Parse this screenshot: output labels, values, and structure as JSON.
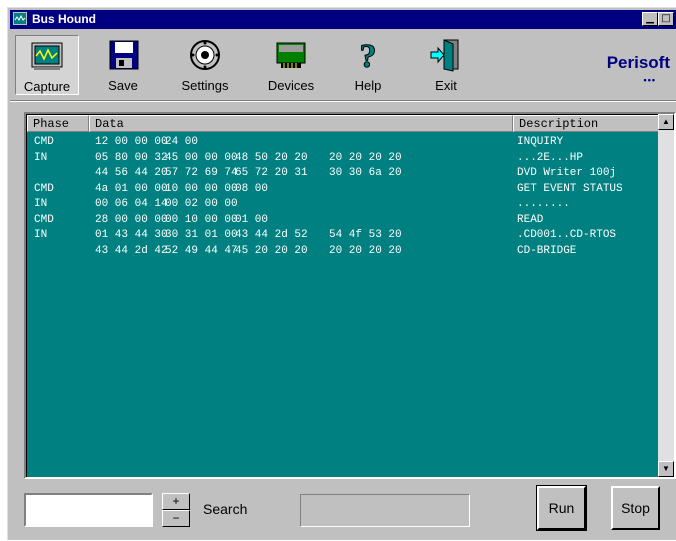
{
  "window": {
    "title": "Bus Hound"
  },
  "toolbar": {
    "capture": "Capture",
    "save": "Save",
    "settings": "Settings",
    "devices": "Devices",
    "help": "Help",
    "exit": "Exit"
  },
  "brand": {
    "name": "Perisoft",
    "dots": "•••"
  },
  "table": {
    "columns": [
      "Phase",
      "Data",
      "Description"
    ],
    "rows": [
      {
        "phase": "CMD",
        "d1": "12 00 00 00",
        "d2": "24 00",
        "d3": "",
        "d4": "",
        "desc": "INQUIRY"
      },
      {
        "phase": "IN",
        "d1": "05 80 00 32",
        "d2": "45 00 00 00",
        "d3": "48 50 20 20",
        "d4": "20 20 20 20",
        "desc": "...2E...HP"
      },
      {
        "phase": "",
        "d1": "44 56 44 20",
        "d2": "57 72 69 74",
        "d3": "65 72 20 31",
        "d4": "30 30 6a 20",
        "desc": "DVD Writer 100j"
      },
      {
        "phase": "CMD",
        "d1": "4a 01 00 00",
        "d2": "10 00 00 00",
        "d3": "08 00",
        "d4": "",
        "desc": "GET EVENT STATUS"
      },
      {
        "phase": "IN",
        "d1": "00 06 04 14",
        "d2": "00 02 00 00",
        "d3": "",
        "d4": "",
        "desc": "........"
      },
      {
        "phase": "CMD",
        "d1": "28 00 00 00",
        "d2": "00 10 00 00",
        "d3": "01 00",
        "d4": "",
        "desc": "READ"
      },
      {
        "phase": "IN",
        "d1": "01 43 44 30",
        "d2": "30 31 01 00",
        "d3": "43 44 2d 52",
        "d4": "54 4f 53 20",
        "desc": ".CD001..CD-RTOS"
      },
      {
        "phase": "",
        "d1": "43 44 2d 42",
        "d2": "52 49 44 47",
        "d3": "45 20 20 20",
        "d4": "20 20 20 20",
        "desc": "CD-BRIDGE"
      }
    ]
  },
  "bottom": {
    "search_label": "Search",
    "search_value": "",
    "run": "Run",
    "stop": "Stop"
  },
  "colors": {
    "list_bg": "#008080",
    "title_bg": "#000080",
    "face": "#c0c0c0"
  },
  "icons": [
    "capture-icon",
    "save-icon",
    "settings-icon",
    "devices-icon",
    "help-icon",
    "exit-icon"
  ]
}
